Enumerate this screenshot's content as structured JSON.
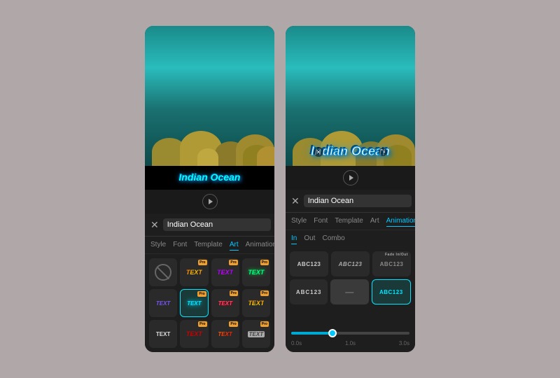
{
  "panels": {
    "left": {
      "title": "Indian Ocean",
      "tabs": [
        "Style",
        "Font",
        "Template",
        "Art",
        "Animation"
      ],
      "active_tab": "Art",
      "search_placeholder": "Indian Ocean",
      "art_items": [
        {
          "id": "none",
          "type": "none",
          "label": ""
        },
        {
          "id": "art1",
          "type": "text",
          "label": "TEXT",
          "style": "art1",
          "pro": true
        },
        {
          "id": "art2",
          "type": "text",
          "label": "TEXT",
          "style": "art2",
          "pro": true
        },
        {
          "id": "art3",
          "type": "text",
          "label": "TEXT",
          "style": "art3",
          "pro": true
        },
        {
          "id": "art4",
          "type": "text",
          "label": "TEXT",
          "style": "art4",
          "selected": true,
          "pro": true
        },
        {
          "id": "art5",
          "type": "text",
          "label": "TEXT",
          "style": "art5",
          "pro": true
        },
        {
          "id": "art6",
          "type": "text",
          "label": "TEXT",
          "style": "art6",
          "pro": true
        },
        {
          "id": "art7",
          "type": "text",
          "label": "TEXT",
          "style": "art7"
        },
        {
          "id": "art8",
          "type": "text",
          "label": "TEXT",
          "style": "art8"
        },
        {
          "id": "art9",
          "type": "text",
          "label": "TEXT",
          "style": "art9",
          "pro": true
        }
      ]
    },
    "right": {
      "title": "Indian Ocean",
      "tabs": [
        "Style",
        "Font",
        "Template",
        "Art",
        "Animation"
      ],
      "active_tab": "Animation",
      "search_placeholder": "Indian Ocean",
      "anim_tabs": [
        "In",
        "Out",
        "Combo"
      ],
      "active_anim_tab": "In",
      "anim_items_row1": [
        {
          "id": "anim1",
          "label": "ABC123",
          "sublabel": ""
        },
        {
          "id": "anim2",
          "label": "ABC123",
          "sublabel": ""
        },
        {
          "id": "anim3",
          "label": "ABC123",
          "sublabel": "Fade In/Out"
        }
      ],
      "anim_items_row2": [
        {
          "id": "anim4",
          "label": "ABC123",
          "sublabel": ""
        },
        {
          "id": "anim5",
          "label": "—",
          "sublabel": ""
        },
        {
          "id": "anim6",
          "label": "ABC123",
          "sublabel": "",
          "selected": true
        }
      ],
      "timeline": {
        "start": "0.0s",
        "marker": "1.0s",
        "end": "3.0s",
        "progress": 35
      }
    }
  },
  "preview": {
    "title_text": "Indian Ocean",
    "play_label": "▶"
  }
}
